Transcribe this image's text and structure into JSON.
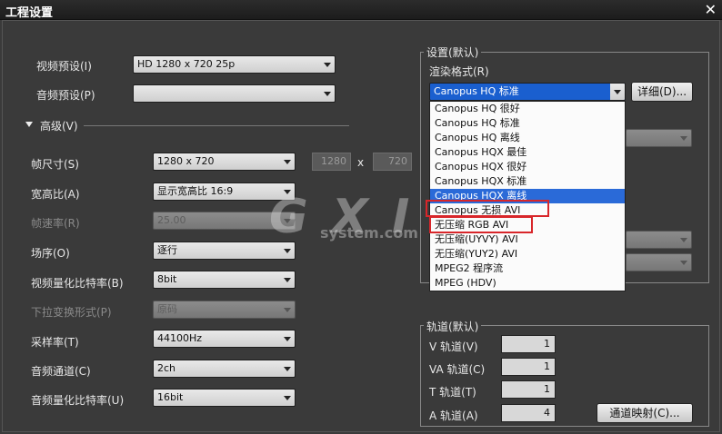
{
  "window": {
    "title": "工程设置",
    "close": "✕"
  },
  "left": {
    "video_preset_label": "视频预设(I)",
    "video_preset_value": "HD 1280 x 720 25p",
    "audio_preset_label": "音频预设(P)",
    "audio_preset_value": "",
    "advanced_label": "高级(V)",
    "frame_size_label": "帧尺寸(S)",
    "frame_size_value": "1280 x 720",
    "width_value": "1280",
    "times": "x",
    "height_value": "720",
    "aspect_label": "宽高比(A)",
    "aspect_value": "显示宽高比 16:9",
    "frame_rate_label": "帧速率(R)",
    "frame_rate_value": "25.00",
    "field_label": "场序(O)",
    "field_value": "逐行",
    "video_bits_label": "视频量化比特率(B)",
    "video_bits_value": "8bit",
    "pulldown_label": "下拉变换形式(P)",
    "pulldown_value": "原码",
    "sample_rate_label": "采样率(T)",
    "sample_rate_value": "44100Hz",
    "audio_channel_label": "音频通道(C)",
    "audio_channel_value": "2ch",
    "audio_bits_label": "音频量化比特率(U)",
    "audio_bits_value": "16bit"
  },
  "settings_group": {
    "title": "设置(默认)",
    "render_label": "渲染格式(R)",
    "render_value": "Canopus HQ 标准",
    "detail_button": "详细(D)...",
    "options": [
      "Canopus HQ 很好",
      "Canopus HQ 标准",
      "Canopus HQ 离线",
      "Canopus HQX 最佳",
      "Canopus HQX 很好",
      "Canopus HQX 标准",
      "Canopus HQX 离线",
      "Canopus 无损 AVI",
      "无压缩 RGB AVI",
      "无压缩(UYVY) AVI",
      "无压缩(YUY2) AVI",
      "MPEG2 程序流",
      "MPEG (HDV)"
    ],
    "selected_index": 6
  },
  "tracks_group": {
    "title": "轨道(默认)",
    "v_label": "V 轨道(V)",
    "v_value": "1",
    "va_label": "VA 轨道(C)",
    "va_value": "1",
    "t_label": "T 轨道(T)",
    "t_value": "1",
    "a_label": "A 轨道(A)",
    "a_value": "4",
    "map_button": "通道映射(C)..."
  },
  "watermark": {
    "main": "G X I 网",
    "sub": "system.com"
  }
}
